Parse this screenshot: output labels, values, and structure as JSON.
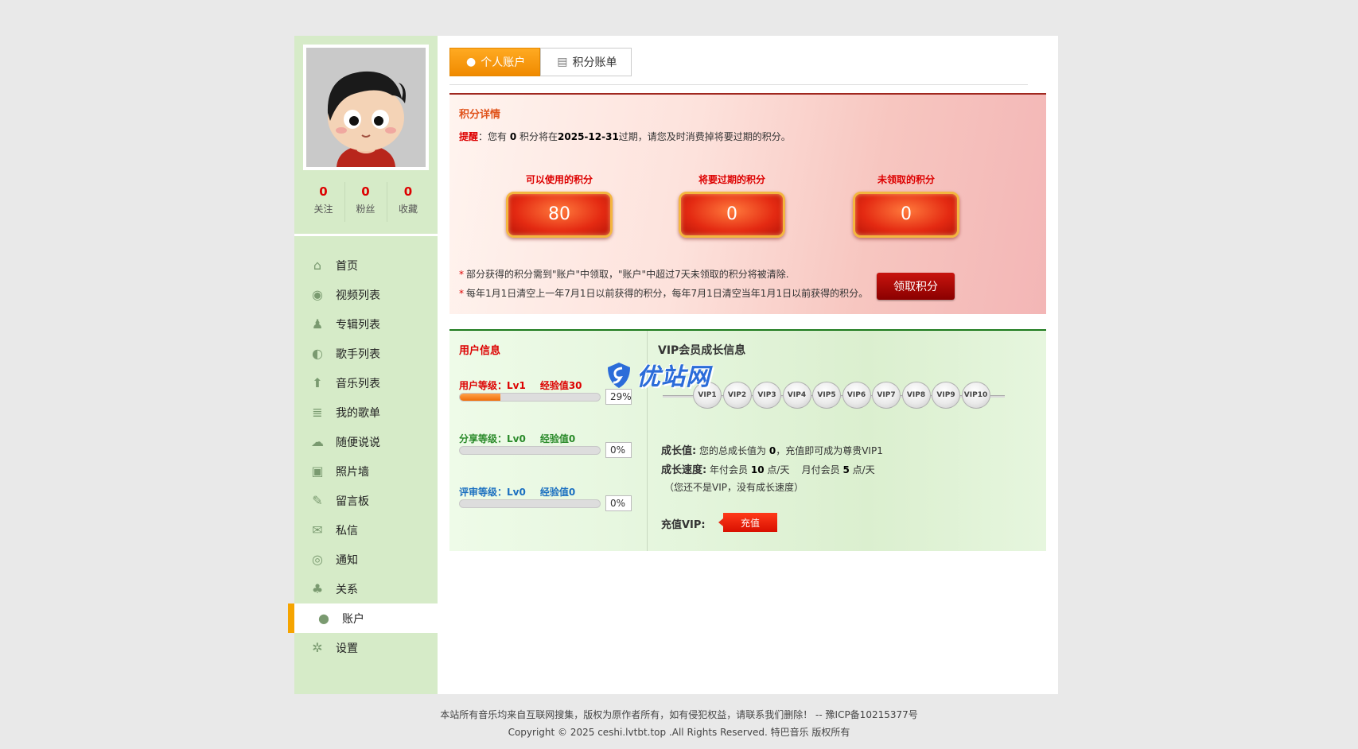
{
  "profile": {
    "stats": [
      {
        "value": "0",
        "label": "关注"
      },
      {
        "value": "0",
        "label": "粉丝"
      },
      {
        "value": "0",
        "label": "收藏"
      }
    ]
  },
  "menu": [
    {
      "label": "首页",
      "icon": "home-icon",
      "glyph": "⌂"
    },
    {
      "label": "视频列表",
      "icon": "eye-icon",
      "glyph": "◉"
    },
    {
      "label": "专辑列表",
      "icon": "group-icon",
      "glyph": "♟"
    },
    {
      "label": "歌手列表",
      "icon": "pacman-icon",
      "glyph": "◐"
    },
    {
      "label": "音乐列表",
      "icon": "upload-icon",
      "glyph": "⬆"
    },
    {
      "label": "我的歌单",
      "icon": "document-icon",
      "glyph": "≣"
    },
    {
      "label": "随便说说",
      "icon": "chat-icon",
      "glyph": "☁"
    },
    {
      "label": "照片墙",
      "icon": "image-icon",
      "glyph": "▣"
    },
    {
      "label": "留言板",
      "icon": "note-icon",
      "glyph": "✎"
    },
    {
      "label": "私信",
      "icon": "mail-icon",
      "glyph": "✉"
    },
    {
      "label": "通知",
      "icon": "broadcast-icon",
      "glyph": "◎"
    },
    {
      "label": "关系",
      "icon": "users-icon",
      "glyph": "♣"
    },
    {
      "label": "账户",
      "icon": "user-icon",
      "glyph": "●",
      "active": true
    },
    {
      "label": "设置",
      "icon": "gear-icon",
      "glyph": "✲"
    }
  ],
  "tabs": [
    {
      "label": "个人账户",
      "icon": "user-icon",
      "glyph": "●"
    },
    {
      "label": "积分账单",
      "icon": "coins-icon",
      "glyph": "▤"
    }
  ],
  "points": {
    "title": "积分详情",
    "remind_label": "提醒",
    "remind_pre": "：您有 ",
    "remind_count": "0",
    "remind_mid": " 积分将在",
    "remind_date": "2025-12-31",
    "remind_post": "过期，请您及时消费掉将要过期的积分。",
    "boxes": [
      {
        "title": "可以使用的积分",
        "value": "80"
      },
      {
        "title": "将要过期的积分",
        "value": "0"
      },
      {
        "title": "未领取的积分",
        "value": "0"
      }
    ],
    "note1": "部分获得的积分需到\"账户\"中领取，\"账户\"中超过7天未领取的积分将被清除.",
    "note2": "每年1月1日清空上一年7月1日以前获得的积分，每年7月1日清空当年1月1日以前获得的积分。",
    "claim_button": "领取积分"
  },
  "user_info": {
    "title": "用户信息",
    "levels": [
      {
        "label": "用户等级：Lv1",
        "exp": "经验值30",
        "percent": 29,
        "percent_text": "29%",
        "color": "#d00"
      },
      {
        "label": "分享等级：Lv0",
        "exp": "经验值0",
        "percent": 0,
        "percent_text": "0%",
        "color": "#2a8a2a"
      },
      {
        "label": "评审等级：Lv0",
        "exp": "经验值0",
        "percent": 0,
        "percent_text": "0%",
        "color": "#1a6fc0"
      }
    ]
  },
  "vip": {
    "title": "VIP会员成长信息",
    "levels": [
      "VIP1",
      "VIP2",
      "VIP3",
      "VIP4",
      "VIP5",
      "VIP6",
      "VIP7",
      "VIP8",
      "VIP9",
      "VIP10"
    ],
    "growth_label": "成长值:",
    "growth_pre": " 您的总成长值为 ",
    "growth_value": "0",
    "growth_post": "，充值即可成为尊贵VIP1",
    "speed_label": "成长速度:",
    "speed_text1": " 年付会员 ",
    "speed_val1": "10",
    "speed_text2": " 点/天    月付会员 ",
    "speed_val2": "5",
    "speed_text3": " 点/天",
    "speed_note": "（您还不是VIP，没有成长速度）",
    "recharge_label": "充值VIP:",
    "recharge_button": "充值"
  },
  "watermark": "优站网",
  "footer": {
    "line1": "本站所有音乐均来自互联网搜集，版权为原作者所有，如有侵犯权益，请联系我们删除！ -- 豫ICP备10215377号",
    "line2": "Copyright © 2025 ceshi.lvtbt.top .All Rights Reserved. 特巴音乐 版权所有"
  },
  "colors": {
    "accent": "#f5a400",
    "sidebar": "#d6ebc8",
    "points_red": "#d00",
    "panel_green": "#1d7a1d"
  }
}
